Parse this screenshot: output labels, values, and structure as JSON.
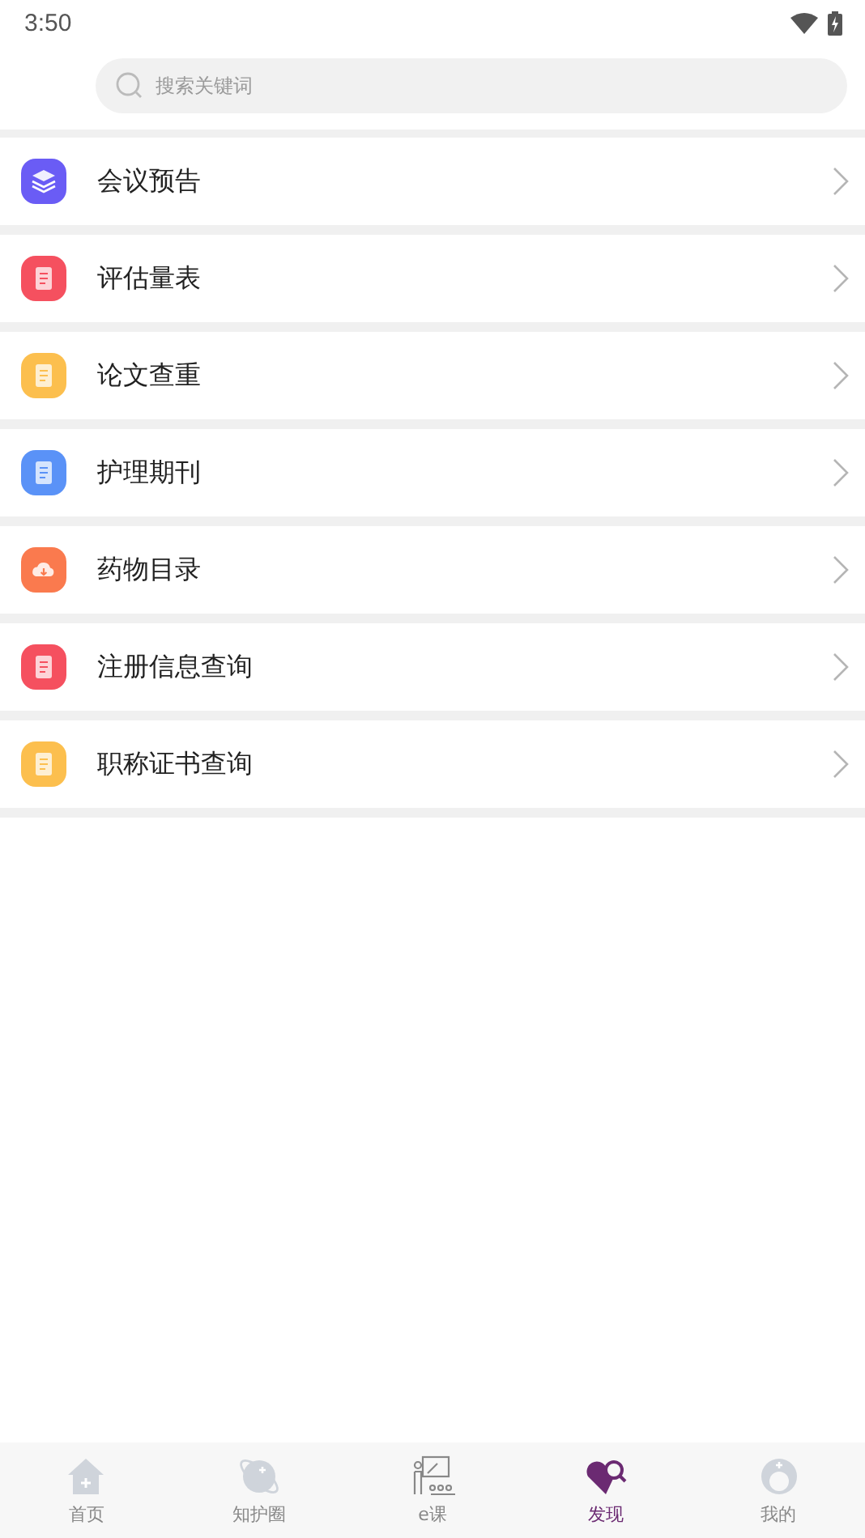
{
  "status_bar": {
    "time": "3:50"
  },
  "search": {
    "placeholder": "搜索关键词"
  },
  "menu_items": [
    {
      "label": "会议预告",
      "kind": "layers",
      "color": "#6a5cf5"
    },
    {
      "label": "评估量表",
      "kind": "document",
      "color": "#f5505f"
    },
    {
      "label": "论文查重",
      "kind": "document",
      "color": "#fcbf4e"
    },
    {
      "label": "护理期刊",
      "kind": "document",
      "color": "#5a92f7"
    },
    {
      "label": "药物目录",
      "kind": "cloud",
      "color": "#fa7a4e"
    },
    {
      "label": "注册信息查询",
      "kind": "document",
      "color": "#f5505f"
    },
    {
      "label": "职称证书查询",
      "kind": "document",
      "color": "#fcbf4e"
    }
  ],
  "tabs": [
    {
      "label": "首页",
      "kind": "home",
      "selected": false
    },
    {
      "label": "知护圈",
      "kind": "planet",
      "selected": false
    },
    {
      "label": "e课",
      "kind": "lecture",
      "selected": false
    },
    {
      "label": "发现",
      "kind": "discover",
      "selected": true
    },
    {
      "label": "我的",
      "kind": "nurse",
      "selected": false
    }
  ]
}
